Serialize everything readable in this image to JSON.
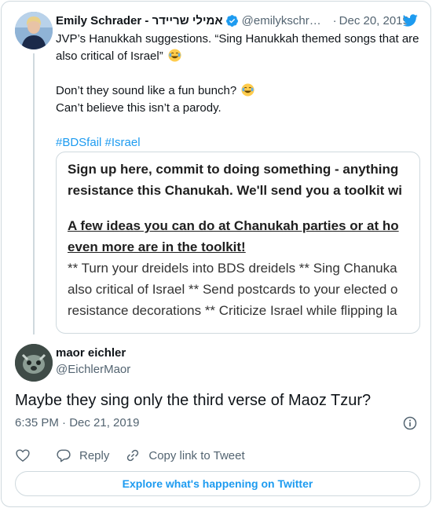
{
  "quoted_tweet": {
    "author_name": "Emily Schrader - אמילי שריידר",
    "author_handle": "@emilykschrader",
    "separator": "·",
    "date": "Dec 20, 2019",
    "text_lines": [
      "JVP’s Hanukkah suggestions. “Sing Hanukkah themed songs that are",
      "also critical of Israel”"
    ],
    "text_lines_2": [
      "Don’t they sound like a fun bunch?",
      "Can’t believe this isn’t a parody."
    ],
    "hashtags": [
      "#BDSfail",
      "#Israel"
    ],
    "media": {
      "line1": "Sign up here, commit to doing something - anything",
      "line2": "resistance this Chanukah. We'll send you a toolkit wi",
      "line3": "A few ideas you can do at Chanukah parties or at ho",
      "line4": "even more are in the toolkit!",
      "line5": "** Turn your dreidels into BDS dreidels ** Sing Chanuka",
      "line6": "also critical of Israel ** Send postcards to your elected o",
      "line7": "resistance decorations ** Criticize Israel while flipping la"
    }
  },
  "main_tweet": {
    "author_name": "maor eichler",
    "author_handle": "@EichlerMaor",
    "text": "Maybe they sing only the third verse of Maoz Tzur?",
    "timestamp": "6:35 PM · Dec 21, 2019"
  },
  "actions": {
    "reply_label": "Reply",
    "copy_link_label": "Copy link to Tweet"
  },
  "explore_label": "Explore what's happening on Twitter",
  "colors": {
    "accent": "#1d9bf0",
    "text": "#0f1419",
    "muted": "#536471",
    "border": "#cfd9de"
  },
  "icons": [
    "verified-badge-icon",
    "twitter-bird-icon",
    "joy-emoji-icon",
    "info-icon",
    "heart-icon",
    "reply-icon",
    "link-icon"
  ]
}
